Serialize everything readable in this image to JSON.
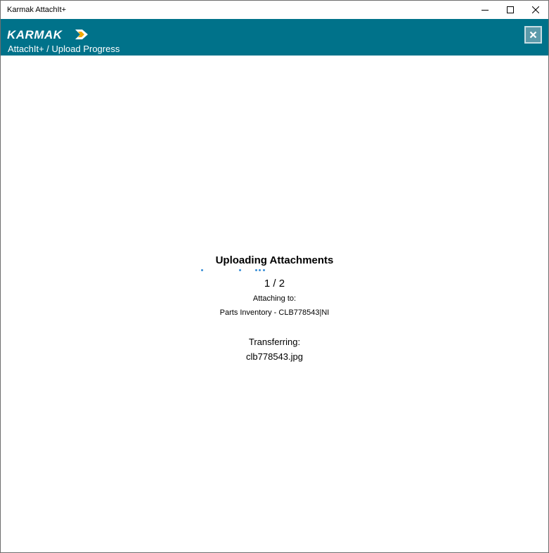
{
  "window": {
    "title": "Karmak AttachIt+"
  },
  "header": {
    "logo_text": "KARMAK",
    "breadcrumb": "AttachIt+ / Upload Progress",
    "background_color": "#00728a"
  },
  "progress": {
    "heading": "Uploading Attachments",
    "counter": "1 / 2",
    "attaching_label": "Attaching to:",
    "attaching_target": "Parts Inventory - CLB778543|NI",
    "transfer_label": "Transferring:",
    "transfer_file": "clb778543.jpg",
    "indicator_color": "#3a8fd6"
  },
  "icons": {
    "minimize": "minimize-icon",
    "maximize": "maximize-icon",
    "close": "close-icon",
    "header_close": "close-icon",
    "logo": "karmak-logo"
  }
}
